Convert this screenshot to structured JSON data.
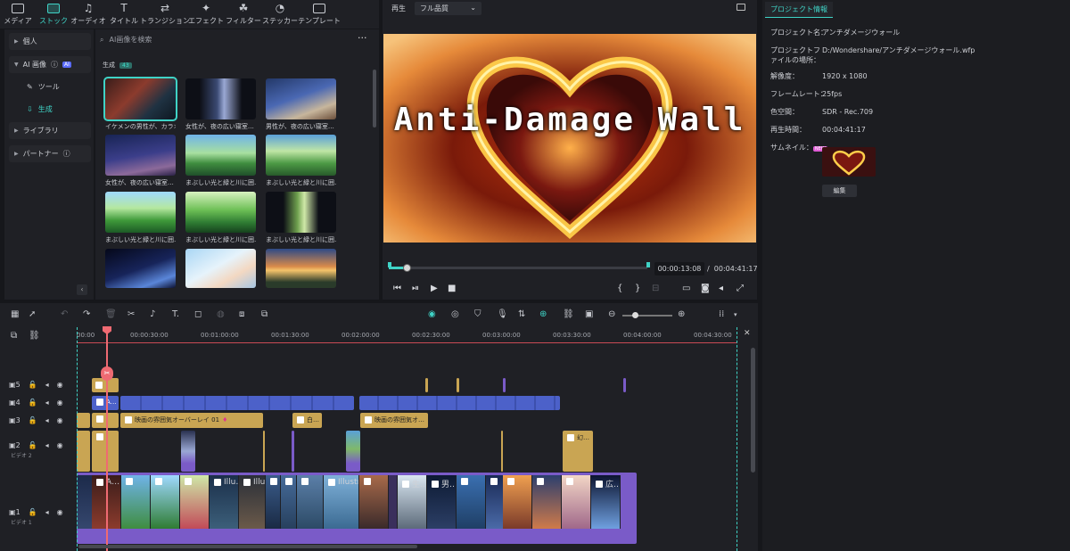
{
  "media_tabs": [
    {
      "label": "メディア",
      "icon": "media-icon"
    },
    {
      "label": "ストック",
      "icon": "stock-icon",
      "active": true
    },
    {
      "label": "オーディオ",
      "icon": "audio-icon"
    },
    {
      "label": "タイトル",
      "icon": "title-icon"
    },
    {
      "label": "トランジション",
      "icon": "transition-icon"
    },
    {
      "label": "エフェクト",
      "icon": "effect-icon"
    },
    {
      "label": "フィルター",
      "icon": "filter-icon"
    },
    {
      "label": "ステッカー",
      "icon": "sticker-icon"
    },
    {
      "label": "テンプレート",
      "icon": "template-icon"
    }
  ],
  "sidebar": {
    "personal": "個人",
    "ai_image": "AI 画像",
    "ai_badge": "AI",
    "tool": "ツール",
    "generate": "生成",
    "library": "ライブラリ",
    "partner": "パートナー"
  },
  "media": {
    "search_placeholder": "AI画像を検索",
    "section_label": "生成",
    "section_count": "43",
    "thumbs": [
      {
        "caption": "イケメンの男性が、カラオ…"
      },
      {
        "caption": "女性が、夜の広い寝室…"
      },
      {
        "caption": "男性が、夜の広い寝室…"
      },
      {
        "caption": "女性が、夜の広い寝室…"
      },
      {
        "caption": "まぶしい光と緑と川に囲…"
      },
      {
        "caption": "まぶしい光と緑と川に囲…"
      },
      {
        "caption": "まぶしい光と緑と川に囲…"
      },
      {
        "caption": "まぶしい光と緑と川に囲…"
      },
      {
        "caption": "まぶしい光と緑と川に囲…"
      },
      {
        "caption": ""
      },
      {
        "caption": ""
      },
      {
        "caption": ""
      }
    ]
  },
  "player": {
    "label": "再生",
    "quality": "フル品質",
    "title_overlay": "Anti-Damage Wall",
    "current_time": "00:00:13:08",
    "separator": "/",
    "duration": "00:04:41:17",
    "progress_fraction": 0.07
  },
  "project_info": {
    "tab": "プロジェクト情報",
    "rows": [
      {
        "k": "プロジェクト名：",
        "v": "アンチダメージウォール"
      },
      {
        "k": "プロジェクトファイルの場所：",
        "v": "D:/Wondershare/アンチダメージウォール.wfp"
      },
      {
        "k": "解像度：",
        "v": "1920 x 1080"
      },
      {
        "k": "フレームレート：",
        "v": "25fps"
      },
      {
        "k": "色空間：",
        "v": "SDR - Rec.709"
      },
      {
        "k": "再生時間：",
        "v": "00:04:41:17"
      }
    ],
    "thumb_label": "サムネイル：",
    "new_badge": "NEW",
    "edit_button": "編集"
  },
  "timeline": {
    "ruler": [
      "00:00",
      "00:00:30:00",
      "00:01:00:00",
      "00:01:30:00",
      "00:02:00:00",
      "00:02:30:00",
      "00:03:00:00",
      "00:03:30:00",
      "00:04:00:00",
      "00:04:30:00"
    ],
    "tracks": [
      {
        "num": "5",
        "name": ""
      },
      {
        "num": "4",
        "name": ""
      },
      {
        "num": "3",
        "name": ""
      },
      {
        "num": "2",
        "name": "ビデオ 2"
      },
      {
        "num": "1",
        "name": "ビデオ 1"
      }
    ],
    "clip_overlay_1": "映画の雰囲気オーバーレイ 01",
    "clip_overlay_2": "映画の雰囲気オ…",
    "clip_small_1": "白…",
    "clip_small_2": "幻…",
    "clip_text_a": "A…",
    "film_labels": [
      "A…",
      "",
      "",
      "",
      "",
      "Illu…",
      "Illustr…",
      "",
      "",
      "",
      "Illustr…",
      "",
      "",
      "生…",
      "男…",
      "",
      "",
      "",
      "",
      "広…"
    ],
    "cut_marker": "✂"
  }
}
